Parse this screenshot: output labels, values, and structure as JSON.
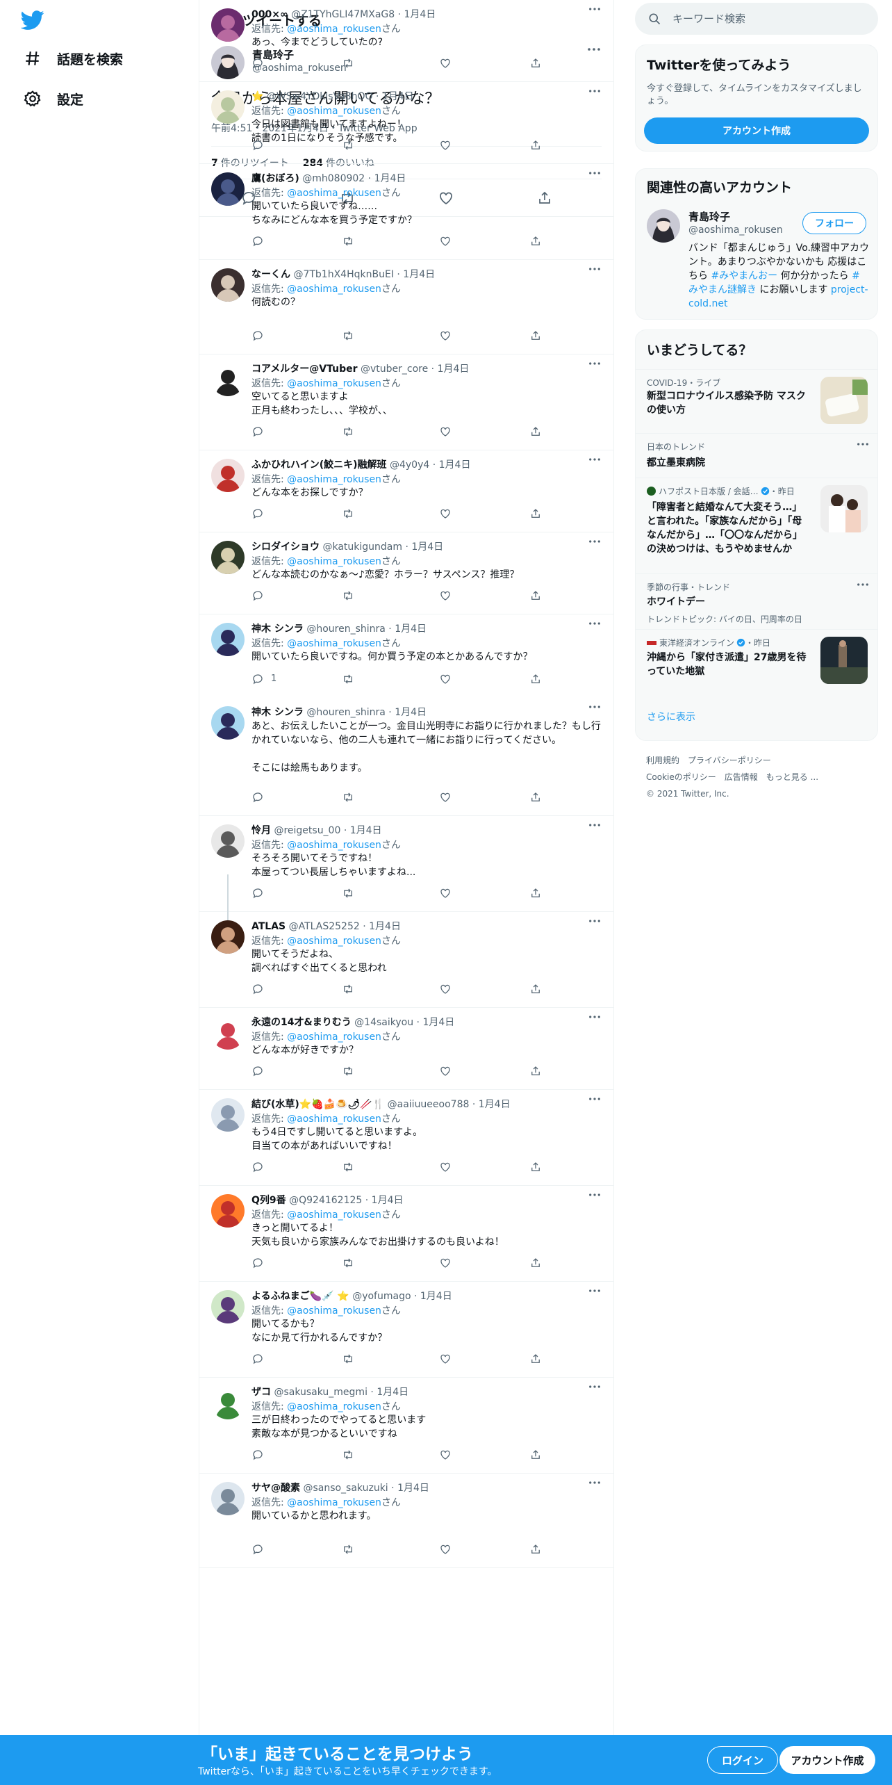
{
  "colors": {
    "accent": "#1d9bf0",
    "text": "#0f1419",
    "secondary": "#536471",
    "border": "#eff3f4"
  },
  "nav": {
    "logo_icon": "twitter-bird-icon",
    "explore_label": "話題を検索",
    "settings_label": "設定"
  },
  "header": {
    "title": "ツイートする"
  },
  "focal": {
    "name": "青島玲子",
    "handle": "@aoshima_rokusen",
    "text": "今日から本屋さん開いてるかな？",
    "meta": "午前4:51・2021年1月4日・Twitter Web App",
    "retweets_count": "7",
    "retweets_label": "件のリツイート",
    "likes_count": "284",
    "likes_label": "件のいいね"
  },
  "replies": [
    {
      "name": "000×∞",
      "handle": "@Z1TYhGLI47MXaG8",
      "date": "1月4日",
      "reply_to_label": "返信先:",
      "reply_to": "@aoshima_rokusen",
      "san": "さん",
      "text": "あっ、今までどうしていたの?"
    },
    {
      "name": "⭐",
      "handle": "@WSw4YDklsVa8hOO",
      "date": "1月4日",
      "reply_to_label": "返信先:",
      "reply_to": "@aoshima_rokusen",
      "san": "さん",
      "text": "今日は図書館も開いてますよねー！\n読書の1日になりそうな予感です。"
    },
    {
      "name": "鷹(おぼろ)",
      "handle": "@mh080902",
      "date": "1月4日",
      "reply_to_label": "返信先:",
      "reply_to": "@aoshima_rokusen",
      "san": "さん",
      "text": "開いていたら良いですね……\nちなみにどんな本を買う予定ですか？"
    },
    {
      "name": "なーくん",
      "handle": "@7Tb1hX4HqknBuEI",
      "date": "1月4日",
      "reply_to_label": "返信先:",
      "reply_to": "@aoshima_rokusen",
      "san": "さん",
      "text": "何読むの？"
    },
    {
      "name": "コアメルター@VTuber",
      "handle": "@vtuber_core",
      "date": "1月4日",
      "reply_to_label": "返信先:",
      "reply_to": "@aoshima_rokusen",
      "san": "さん",
      "text": "空いてると思いますよ\n正月も終わったし、、、学校が、、"
    },
    {
      "name": "ふかひれハイン(鮫ニキ)融解班",
      "handle": "@4y0y4",
      "date": "1月4日",
      "reply_to_label": "返信先:",
      "reply_to": "@aoshima_rokusen",
      "san": "さん",
      "text": "どんな本をお探しですか？"
    },
    {
      "name": "シロダイショウ",
      "handle": "@katukigundam",
      "date": "1月4日",
      "reply_to_label": "返信先:",
      "reply_to": "@aoshima_rokusen",
      "san": "さん",
      "text": "どんな本読むのかなぁ～♪恋愛？ホラー？サスペンス？推理？"
    },
    {
      "name": "神木 シンラ",
      "handle": "@houren_shinra",
      "date": "1月4日",
      "reply_to_label": "返信先:",
      "reply_to": "@aoshima_rokusen",
      "san": "さん",
      "text": "開いていたら良いですね。何か買う予定の本とかあるんですか？",
      "reply_count": "1"
    },
    {
      "name": "神木 シンラ",
      "handle": "@houren_shinra",
      "date": "1月4日",
      "text": "あと、お伝えしたいことが一つ。金目山光明寺にお詣りに行かれました？もし行かれていないなら、他の二人も連れて一緒にお詣りに行ってください。\n\nそこには絵馬もあります。"
    },
    {
      "name": "怜月",
      "handle": "@reigetsu_00",
      "date": "1月4日",
      "reply_to_label": "返信先:",
      "reply_to": "@aoshima_rokusen",
      "san": "さん",
      "text": "そろそろ開いてそうですね！\n本屋ってつい長居しちゃいますよね..."
    },
    {
      "name": "ATLAS",
      "handle": "@ATLAS25252",
      "date": "1月4日",
      "reply_to_label": "返信先:",
      "reply_to": "@aoshima_rokusen",
      "san": "さん",
      "text": "開いてそうだよね、\n調べればすぐ出てくると思われ"
    },
    {
      "name": "永遠の14才&まりむう",
      "handle": "@14saikyou",
      "date": "1月4日",
      "reply_to_label": "返信先:",
      "reply_to": "@aoshima_rokusen",
      "san": "さん",
      "text": "どんな本が好きですか？"
    },
    {
      "name": "結び(水草)⭐🍓🍰🍮🌶🥢🍴",
      "handle": "@aaiiuueeoo788",
      "date": "1月4日",
      "reply_to_label": "返信先:",
      "reply_to": "@aoshima_rokusen",
      "san": "さん",
      "text": "もう4日ですし開いてると思いますよ。\n目当ての本があればいいですね！"
    },
    {
      "name": "Q列9番",
      "handle": "@Q924162125",
      "date": "1月4日",
      "reply_to_label": "返信先:",
      "reply_to": "@aoshima_rokusen",
      "san": "さん",
      "text": "きっと開いてるよ！\n天気も良いから家族みんなでお出掛けするのも良いよね！"
    },
    {
      "name": "よるふねまご🍆💉 ⭐",
      "handle": "@yofumago",
      "date": "1月4日",
      "reply_to_label": "返信先:",
      "reply_to": "@aoshima_rokusen",
      "san": "さん",
      "text": "開いてるかも？\nなにか見て行かれるんですか？"
    },
    {
      "name": "ザコ",
      "handle": "@sakusaku_megmi",
      "date": "1月4日",
      "reply_to_label": "返信先:",
      "reply_to": "@aoshima_rokusen",
      "san": "さん",
      "text": "三が日終わったのでやってると思います\n素敵な本が見つかるといいですね"
    },
    {
      "name": "サヤ@酸素",
      "handle": "@sanso_sakuzuki",
      "date": "1月4日",
      "reply_to_label": "返信先:",
      "reply_to": "@aoshima_rokusen",
      "san": "さん",
      "text": "開いているかと思われます。"
    }
  ],
  "sidebar": {
    "search_placeholder": "キーワード検索",
    "signup_card": {
      "title": "Twitterを使ってみよう",
      "desc": "今すぐ登録して、タイムラインをカスタマイズしましょう。",
      "button": "アカウント作成"
    },
    "related": {
      "title": "関連性の高いアカウント",
      "name": "青島玲子",
      "handle": "@aoshima_rokusen",
      "follow": "フォロー",
      "bio_part1": "バンド「都まんじゅう」Vo.練習中アカウント。あまりつぶやかないかも 応援はこちら ",
      "bio_tag1": "#みやまんおー",
      "bio_part2": " 何か分かったら ",
      "bio_tag2": "#みやまん謎解き",
      "bio_part3": " にお願いします ",
      "bio_link": "project-cold.net"
    },
    "trends": {
      "title": "いまどうしてる？",
      "items": [
        {
          "context": "COVID-19・ライブ",
          "title": "新型コロナウイルス感染予防 マスクの使い方"
        },
        {
          "context": "日本のトレンド",
          "title": "都立墨東病院"
        },
        {
          "context": "ハフポスト日本版 / 会話…",
          "time": "・昨日",
          "title": "「障害者と結婚なんて大変そう…」と言われた。「家族なんだから」「母なんだから」…「〇〇なんだから」の決めつけは、もうやめませんか"
        },
        {
          "context": "季節の行事・トレンド",
          "title": "ホワイトデー",
          "sub": "トレンドトピック: バイの日、円周率の日"
        },
        {
          "context": "東洋経済オンライン",
          "time": "・昨日",
          "title": "沖縄から「家付き派遣」27歳男を待っていた地獄"
        }
      ],
      "show_more": "さらに表示"
    },
    "footer": {
      "terms": "利用規約",
      "privacy": "プライバシーポリシー",
      "cookie": "Cookieのポリシー",
      "ads": "広告情報",
      "more": "もっと見る ...",
      "copyright": "© 2021 Twitter, Inc."
    }
  },
  "bottom_bar": {
    "title": "「いま」起きていることを見つけよう",
    "subtitle": "Twitterなら、「いま」起きていることをいち早くチェックできます。",
    "login": "ログイン",
    "signup": "アカウント作成"
  }
}
